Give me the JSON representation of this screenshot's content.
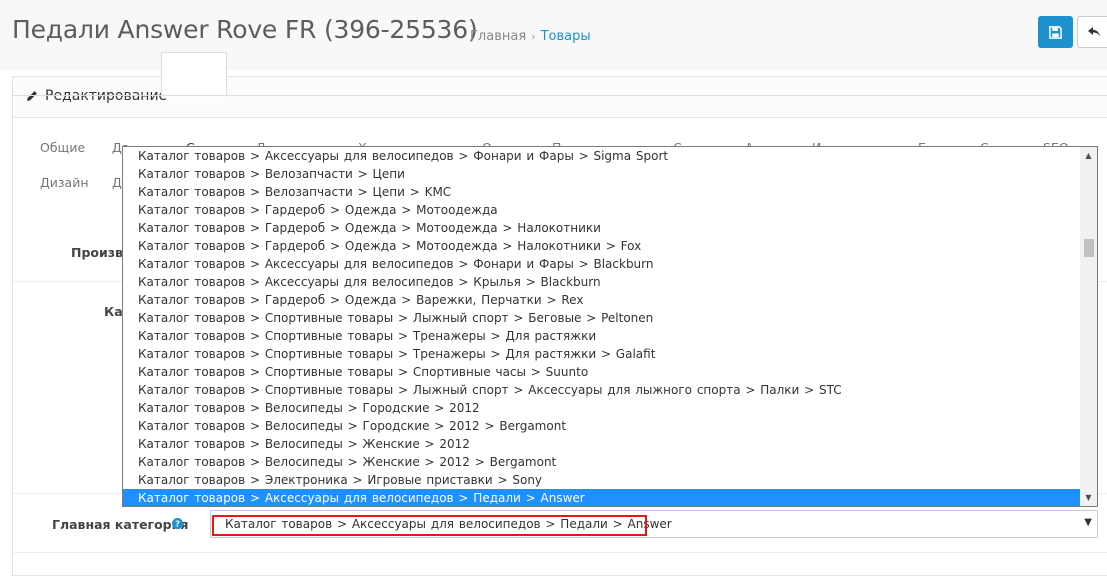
{
  "header": {
    "title": "Педали Answer Rove FR (396-25536)",
    "breadcrumb": {
      "home": "Главная",
      "separator": "›",
      "current": "Товары"
    },
    "save_icon": "floppy-disk-icon",
    "back_icon": "reply-arrow-icon"
  },
  "panel": {
    "title": "Редактирование",
    "title_icon": "pencil-icon",
    "tabs_row1": [
      "Общие",
      "Да",
      "С",
      "Д",
      "Х",
      "О",
      "П",
      "С",
      "А",
      "И",
      "Б",
      "С",
      "SEO"
    ],
    "tabs_row2": [
      "Дизайн",
      "Д"
    ],
    "labels": {
      "manufacturer": "Производ",
      "categories": "Кат",
      "main_category": "Главная категория"
    },
    "help_icon": "question-circle-icon"
  },
  "main_category": {
    "value": "Каталог товаров  >  Аксессуары для велосипедов  >  Педали  >  Answer"
  },
  "dropdown": {
    "options": [
      "Каталог товаров  >  Аксессуары для велосипедов  >  Фонари и Фары  >  Sigma Sport",
      "Каталог товаров  >  Велозапчасти  >  Цепи",
      "Каталог товаров  >  Велозапчасти  >  Цепи  >  KMC",
      "Каталог товаров  >  Гардероб  >  Одежда  >  Мотоодежда",
      "Каталог товаров  >  Гардероб  >  Одежда  >  Мотоодежда  >  Налокотники",
      "Каталог товаров  >  Гардероб  >  Одежда  >  Мотоодежда  >  Налокотники  >  Fox",
      "Каталог товаров  >  Аксессуары для велосипедов  >  Фонари и Фары  >  Blackburn",
      "Каталог товаров  >  Аксессуары для велосипедов  >  Крылья  >  Blackburn",
      "Каталог товаров  >  Гардероб  >  Одежда  >  Варежки, Перчатки  >  Rex",
      "Каталог товаров  >  Спортивные товары  >  Лыжный спорт  >  Беговые  >  Peltonen",
      "Каталог товаров  >  Спортивные товары  >  Тренажеры  >  Для растяжки",
      "Каталог товаров  >  Спортивные товары  >  Тренажеры  >  Для растяжки  >  Galafit",
      "Каталог товаров  >  Спортивные товары  >  Спортивные часы  >  Suunto",
      "Каталог товаров  >  Спортивные товары  >  Лыжный спорт  >  Аксессуары для лыжного спорта  >  Палки  >  STC",
      "Каталог товаров  >  Велосипеды  >  Городские  >  2012",
      "Каталог товаров  >  Велосипеды  >  Городские  >  2012  >  Bergamont",
      "Каталог товаров  >  Велосипеды  >  Женские  >  2012",
      "Каталог товаров  >  Велосипеды  >  Женские  >  2012  >  Bergamont",
      "Каталог товаров  >  Электроника  >  Игровые приставки  >  Sony",
      "Каталог товаров  >  Аксессуары для велосипедов  >  Педали  >  Answer"
    ],
    "selected_index": 19
  }
}
